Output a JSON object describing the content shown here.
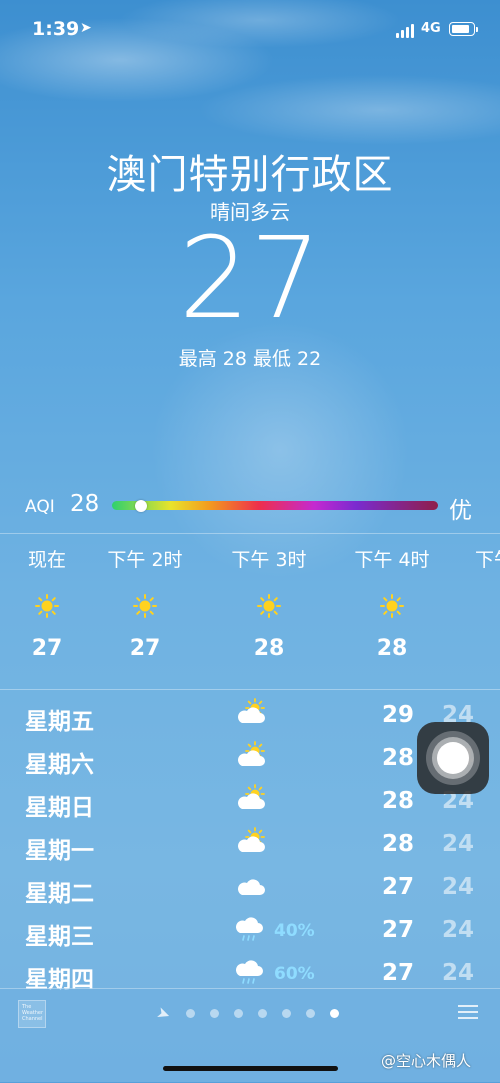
{
  "status_bar": {
    "time": "1:39",
    "network": "4G"
  },
  "header": {
    "city": "澳门特别行政区",
    "condition": "晴间多云",
    "temperature": "27",
    "high_low": "最高 28  最低 22"
  },
  "aqi": {
    "label": "AQI",
    "value": "28",
    "level_fraction": 0.09,
    "text": "优"
  },
  "hourly": [
    {
      "label": "现在",
      "icon": "sun-icon",
      "temp": "27"
    },
    {
      "label": "下午 2时",
      "icon": "sun-icon",
      "temp": "27"
    },
    {
      "label": "下午 3时",
      "icon": "sun-icon",
      "temp": "28"
    },
    {
      "label": "下午 4时",
      "icon": "sun-icon",
      "temp": "28"
    },
    {
      "label": "下午",
      "icon": "",
      "temp": ""
    }
  ],
  "daily": [
    {
      "day": "星期五",
      "icon": "partly-sunny-icon",
      "precip": "",
      "high": "29",
      "low": "24"
    },
    {
      "day": "星期六",
      "icon": "partly-sunny-icon",
      "precip": "",
      "high": "28",
      "low": "24"
    },
    {
      "day": "星期日",
      "icon": "partly-sunny-icon",
      "precip": "",
      "high": "28",
      "low": "24"
    },
    {
      "day": "星期一",
      "icon": "partly-sunny-icon",
      "precip": "",
      "high": "28",
      "low": "24"
    },
    {
      "day": "星期二",
      "icon": "cloud-icon",
      "precip": "",
      "high": "27",
      "low": "24"
    },
    {
      "day": "星期三",
      "icon": "rain-cloud-icon",
      "precip": "40%",
      "high": "27",
      "low": "24"
    },
    {
      "day": "星期四",
      "icon": "rain-cloud-icon",
      "precip": "60%",
      "high": "27",
      "low": "24"
    }
  ],
  "toolbar": {
    "logo_text": "The Weather Channel",
    "page_count": 7,
    "active_page": 7
  },
  "watermark": "@空心木偶人",
  "colors": {
    "sun": "#ffd21f",
    "precip": "#8fdcff"
  }
}
